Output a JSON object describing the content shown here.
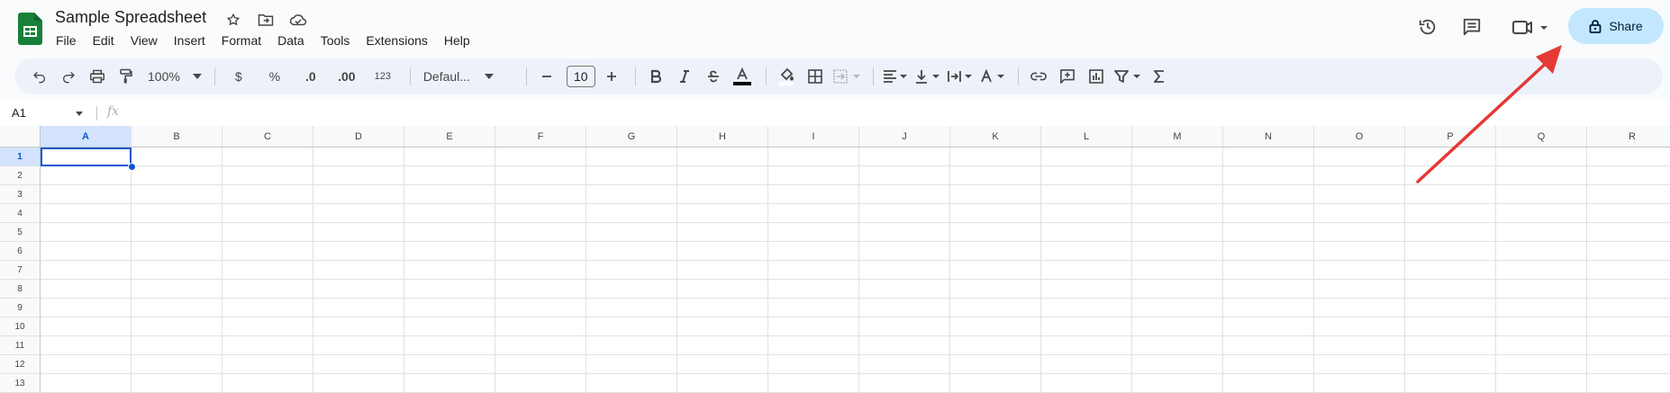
{
  "doc": {
    "title": "Sample Spreadsheet"
  },
  "menu": [
    "File",
    "Edit",
    "View",
    "Insert",
    "Format",
    "Data",
    "Tools",
    "Extensions",
    "Help"
  ],
  "share": {
    "label": "Share"
  },
  "toolbar": {
    "zoom": "100%",
    "currency": "$",
    "percent": "%",
    "dec_decrease": ".0",
    "dec_increase": ".00",
    "number_format": "123",
    "font": "Defaul...",
    "font_size": "10"
  },
  "formula": {
    "cell_ref": "A1",
    "fx": "fx"
  },
  "columns": [
    "A",
    "B",
    "C",
    "D",
    "E",
    "F",
    "G",
    "H",
    "I",
    "J",
    "K",
    "L",
    "M",
    "N",
    "O",
    "P",
    "Q",
    "R"
  ],
  "rows": [
    "1",
    "2",
    "3",
    "4",
    "5",
    "6",
    "7",
    "8",
    "9",
    "10",
    "11",
    "12",
    "13"
  ],
  "selected": {
    "column": "A",
    "row": "1"
  },
  "colors": {
    "share_bg": "#c2e7ff",
    "accent": "#0b57d0",
    "sheets_green": "#188038",
    "annotation": "#e53935"
  },
  "icons": {
    "title": [
      "star-icon",
      "move-to-folder-icon",
      "cloud-saved-icon"
    ],
    "right": [
      "history-icon",
      "comments-icon",
      "video-call-icon"
    ],
    "toolbar": [
      "undo-icon",
      "redo-icon",
      "print-icon",
      "paint-format-icon",
      "bold-icon",
      "italic-icon",
      "strikethrough-icon",
      "text-color-icon",
      "fill-color-icon",
      "borders-icon",
      "merge-cells-icon",
      "horizontal-align-icon",
      "vertical-align-icon",
      "text-wrap-icon",
      "text-rotation-icon",
      "link-icon",
      "comment-icon",
      "chart-icon",
      "filter-icon",
      "functions-icon"
    ]
  }
}
